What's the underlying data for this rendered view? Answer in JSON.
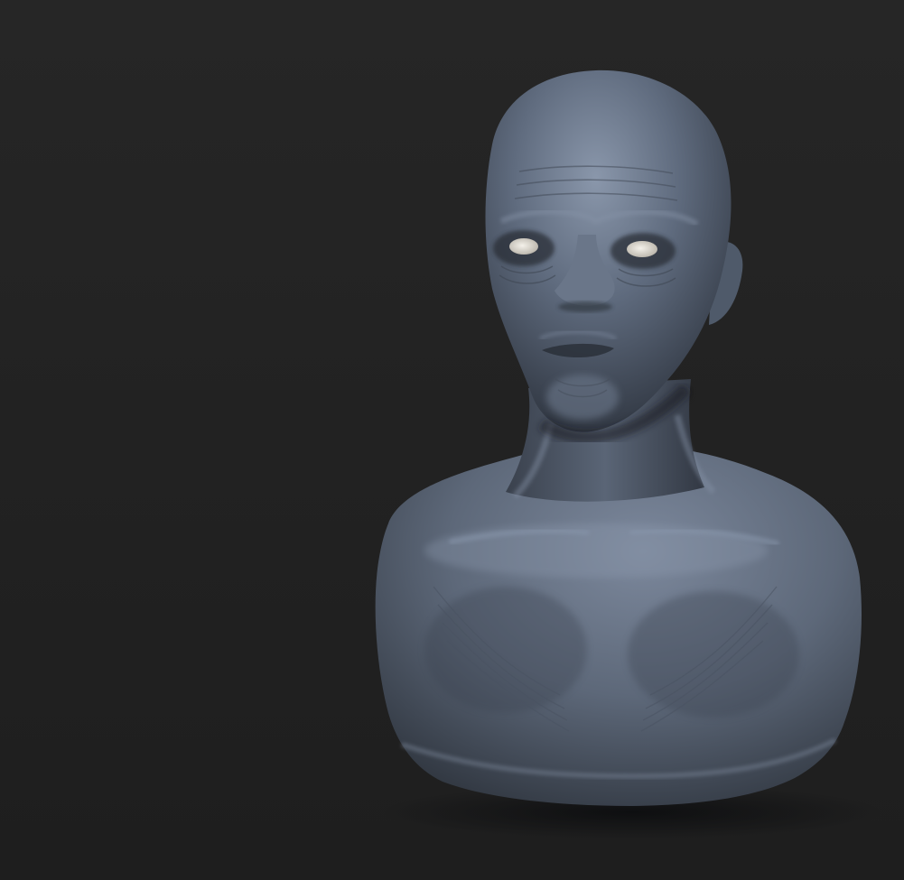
{
  "viewport": {
    "background_color_top": "#262626",
    "background_color_bottom": "#1f1f1f"
  },
  "sculpt": {
    "subject": "bust-sculpt",
    "material_color": "#5b6575",
    "eye_color": "#e8e4dc",
    "shadow_color": "#0f1114"
  }
}
